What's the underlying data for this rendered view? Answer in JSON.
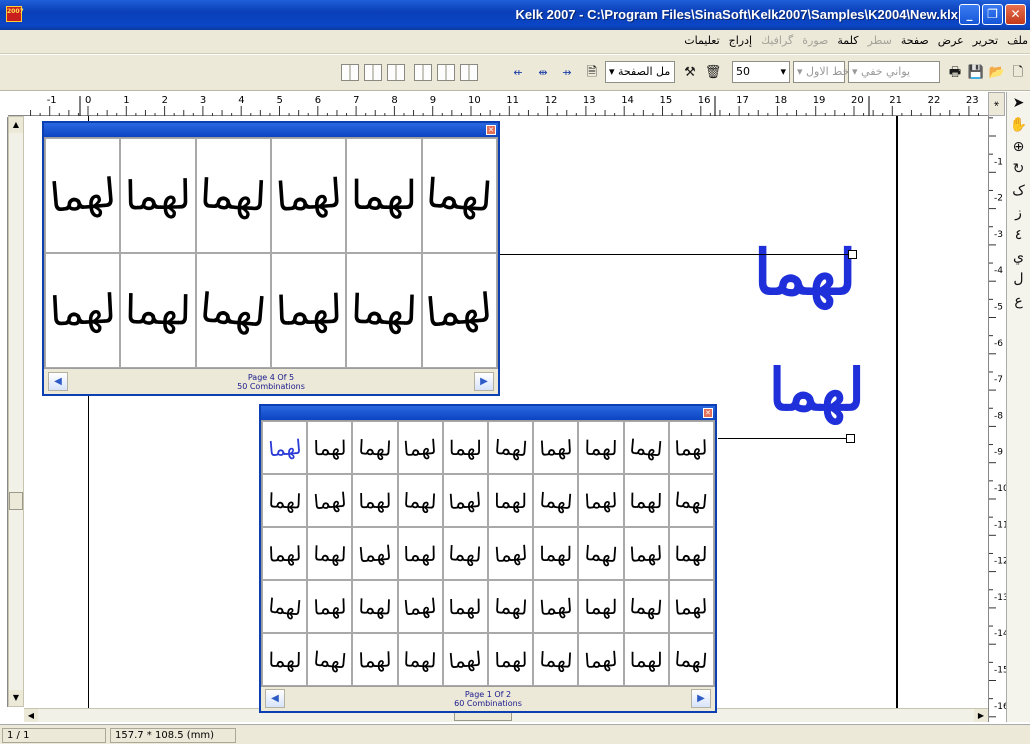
{
  "titlebar": {
    "title": "Kelk 2007 - C:\\Program Files\\SinaSoft\\Kelk2007\\Samples\\K2004\\New.klx",
    "icon_text": "2007",
    "icon": "kelk-app-icon"
  },
  "menu": {
    "items": [
      {
        "label": "ملف",
        "enabled": true
      },
      {
        "label": "تحرير",
        "enabled": true
      },
      {
        "label": "عرض",
        "enabled": true
      },
      {
        "label": "صفحة",
        "enabled": true
      },
      {
        "label": "سطر",
        "enabled": false
      },
      {
        "label": "كلمة",
        "enabled": true
      },
      {
        "label": "صورة",
        "enabled": false
      },
      {
        "label": "گرافيك",
        "enabled": false
      },
      {
        "label": "إدراج",
        "enabled": true
      },
      {
        "label": "تعليمات",
        "enabled": true
      }
    ]
  },
  "toolbar": {
    "zoom": "50",
    "page_fit": "مل الصفحة",
    "line_style": "خط الاول",
    "font_name": "يواني خفي"
  },
  "ruler": {
    "h_labels": [
      "-1",
      "0",
      "1",
      "2",
      "3",
      "4",
      "5",
      "6",
      "7",
      "8",
      "9",
      "10",
      "11",
      "12",
      "13",
      "14",
      "15",
      "16",
      "17",
      "18",
      "19",
      "20",
      "21",
      "22",
      "23"
    ],
    "v_labels": [
      "-1",
      "-2",
      "-3",
      "-4",
      "-5",
      "-6",
      "-7",
      "-8",
      "-9",
      "-10",
      "-11",
      "-12",
      "-13",
      "-14",
      "-15",
      "-16"
    ]
  },
  "popup_large": {
    "page": "Page 4 Of 5",
    "count": "50 Combinations"
  },
  "popup_small": {
    "page": "Page 1 Of 2",
    "count": "60 Combinations"
  },
  "glyph_word": "لهما",
  "status": {
    "page": "1 / 1",
    "size": "157.7 * 108.5 (mm)"
  },
  "colors": {
    "title_blue": "#0a3fb8",
    "glyph_blue": "#2b3bd6"
  }
}
